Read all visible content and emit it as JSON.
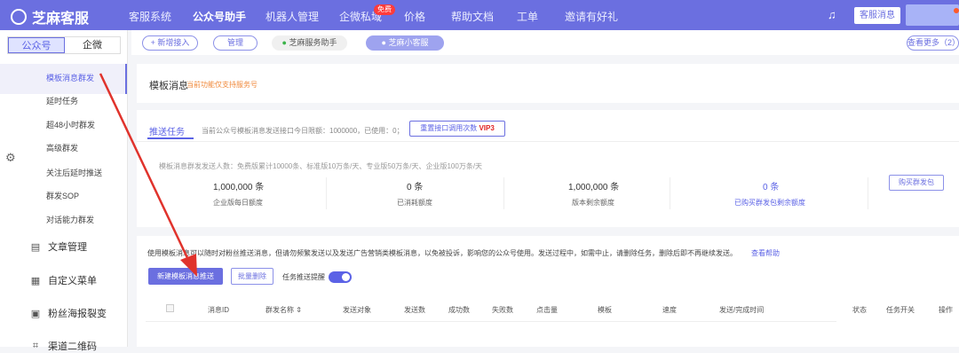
{
  "topbar": {
    "logo": "芝麻客服",
    "nav": [
      "客服系统",
      "公众号助手",
      "机器人管理",
      "企微私域",
      "价格",
      "帮助文档",
      "工单",
      "邀请有好礼"
    ],
    "badge": "免费",
    "msg_btn": "客服消息"
  },
  "sidebar": {
    "seg": [
      "公众号",
      "企微"
    ],
    "sub": [
      "模板消息群发",
      "延时任务",
      "超48小时群发",
      "高级群发",
      "关注后延时推送",
      "群发SOP",
      "对话能力群发"
    ],
    "main": [
      "文章管理",
      "自定义菜单",
      "粉丝海报裂变",
      "渠道二维码"
    ]
  },
  "tabs": {
    "add": "+ 新增接入",
    "manage": "管理",
    "acc1": "芝麻服务助手",
    "acc2": "芝麻小客服",
    "more": "查看更多（2）"
  },
  "card1": {
    "title": "模板消息",
    "hint": "当前功能仅支持服务号"
  },
  "card2": {
    "tab": "推送任务",
    "info": "当前公众号模板消息发送接口今日限额：1000000，已使用：0；",
    "reset": "重置接口调用次数",
    "vip": "VIP3",
    "desc": "模板消息群发发送人数：免费版累计10000条、标准版10万条/天、专业版50万条/天、企业版100万条/天",
    "stats": [
      {
        "value": "1,000,000 条",
        "label": "企业版每日额度"
      },
      {
        "value": "0 条",
        "label": "已消耗额度"
      },
      {
        "value": "1,000,000 条",
        "label": "版本剩余额度"
      },
      {
        "value": "0 条",
        "label": "已购买群发包剩余额度"
      }
    ],
    "buy": "购买群发包"
  },
  "card3": {
    "notice": "使用模板消息可以随时对粉丝推送消息，但请勿频繁发送以及发送广告营销类模板消息，以免被投诉，影响您的公众号使用。发送过程中，如需中止，请删除任务，删除后即不再继续发送。",
    "help": "查看帮助",
    "new_btn": "新建模板消息推送",
    "batch_del": "批量删除",
    "remind": "任务推送提醒",
    "cols": [
      "消息ID",
      "群发名称 ⇕",
      "发送对象",
      "发送数",
      "成功数",
      "失败数",
      "点击量",
      "模板",
      "速度",
      "发送/完成时间",
      "状态",
      "任务开关",
      "操作"
    ]
  },
  "colors": {
    "accent": "#6b6fe0",
    "arrow": "#e0332c"
  }
}
